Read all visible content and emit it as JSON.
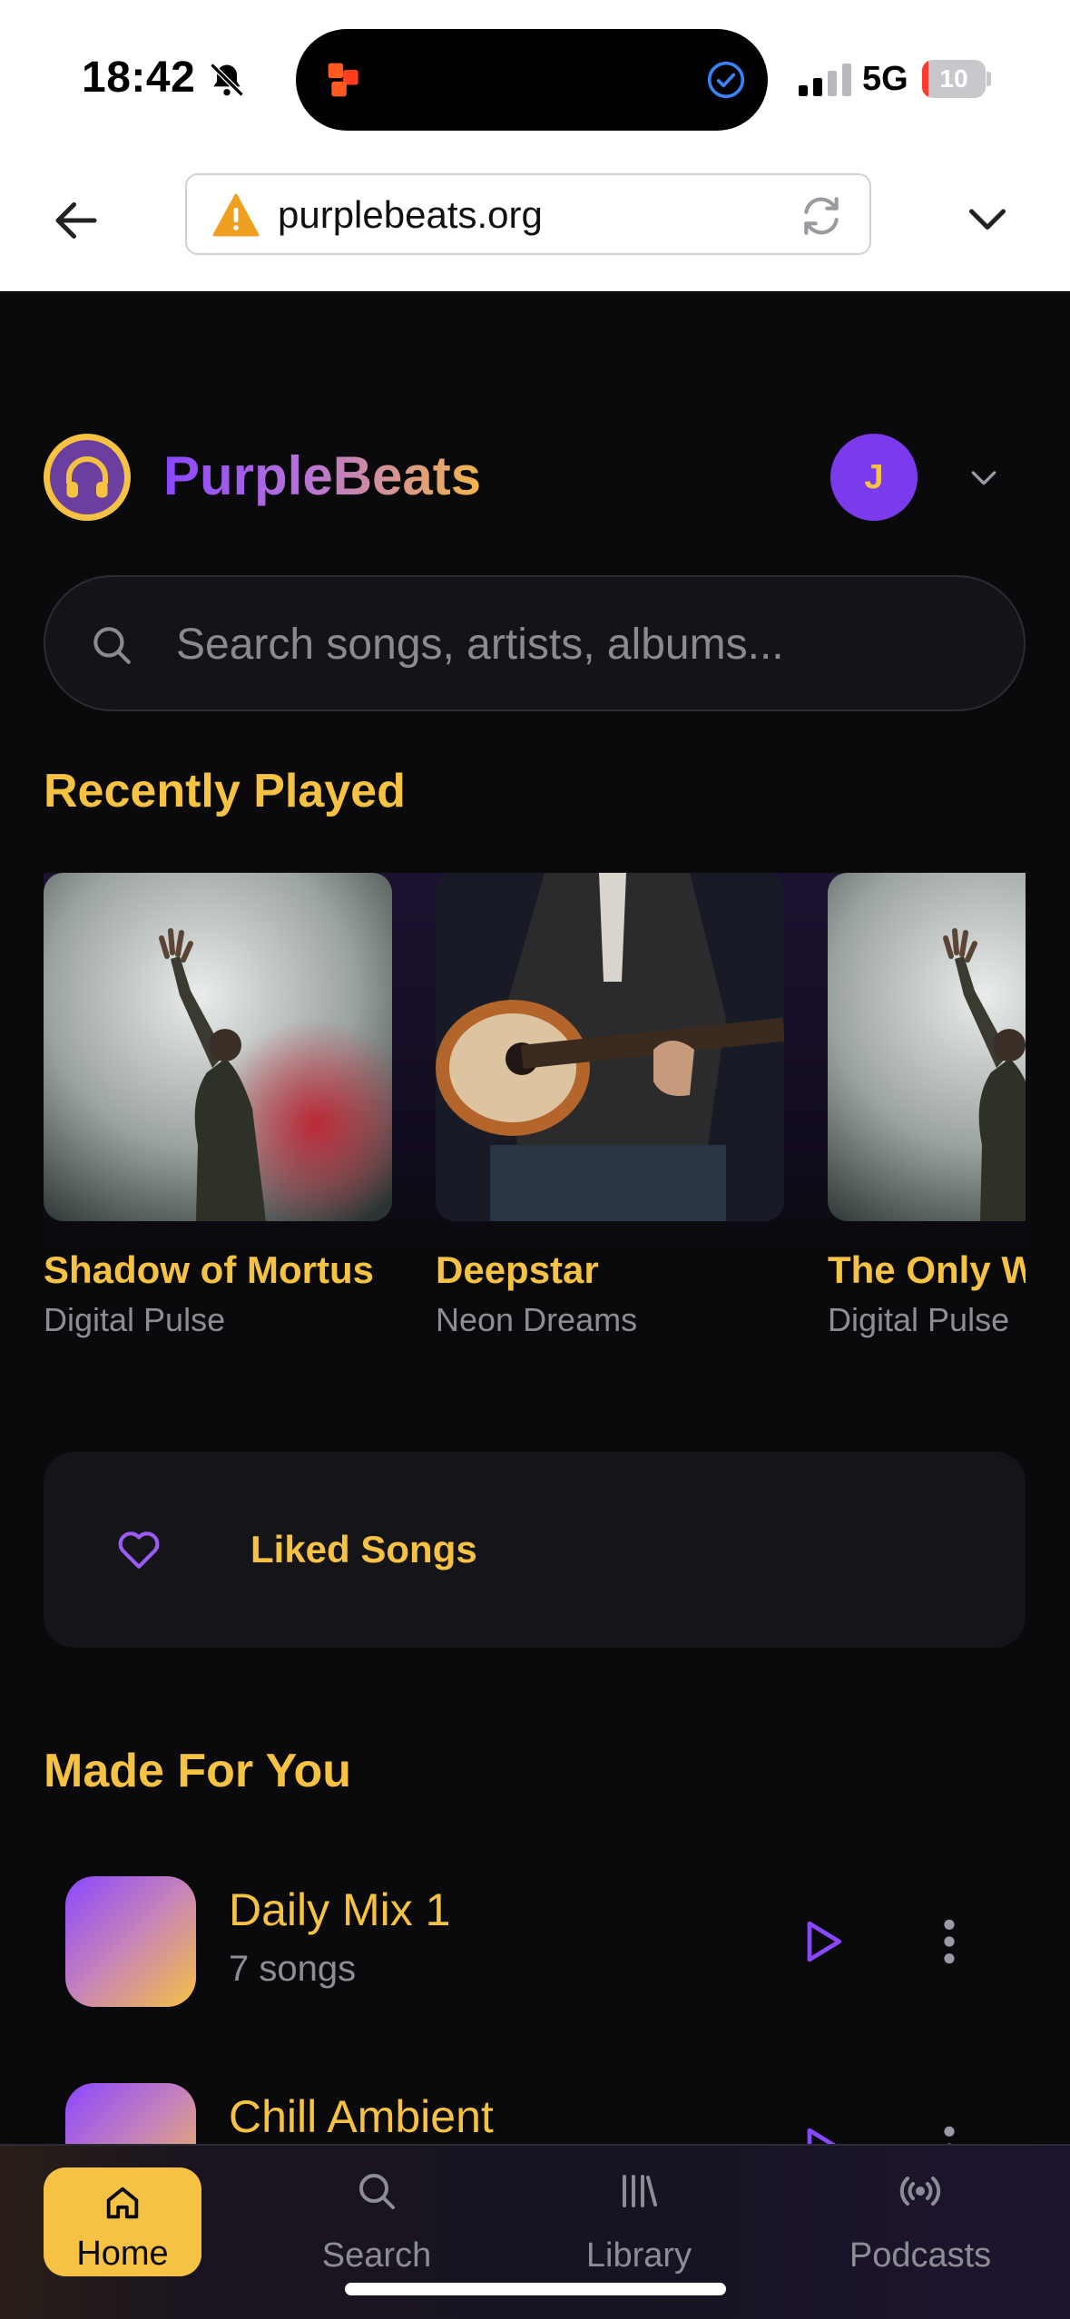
{
  "status_bar": {
    "time": "18:42",
    "network": "5G",
    "battery": "10",
    "battery_level": 0.1
  },
  "browser": {
    "url": "purplebeats.org",
    "security_warning": true
  },
  "app": {
    "name": "PurpleBeats",
    "avatar_initial": "J"
  },
  "search": {
    "placeholder": "Search songs, artists, albums..."
  },
  "recently_played": {
    "title": "Recently Played",
    "items": [
      {
        "title": "Shadow of Mortus",
        "artist": "Digital Pulse"
      },
      {
        "title": "Deepstar",
        "artist": "Neon Dreams"
      },
      {
        "title": "The Only W",
        "artist": "Digital Pulse"
      }
    ]
  },
  "liked": {
    "label": "Liked Songs"
  },
  "made_for_you": {
    "title": "Made For You",
    "playlists": [
      {
        "title": "Daily Mix 1",
        "subtitle": "7 songs"
      },
      {
        "title": "Chill Ambient",
        "subtitle": ""
      }
    ]
  },
  "bottom_nav": {
    "items": [
      {
        "label": "Home",
        "active": true
      },
      {
        "label": "Search",
        "active": false
      },
      {
        "label": "Library",
        "active": false
      },
      {
        "label": "Podcasts",
        "active": false
      }
    ]
  },
  "colors": {
    "accent_gold": "#f6c244",
    "accent_purple": "#7c3aed",
    "background": "#0a0a0c"
  }
}
